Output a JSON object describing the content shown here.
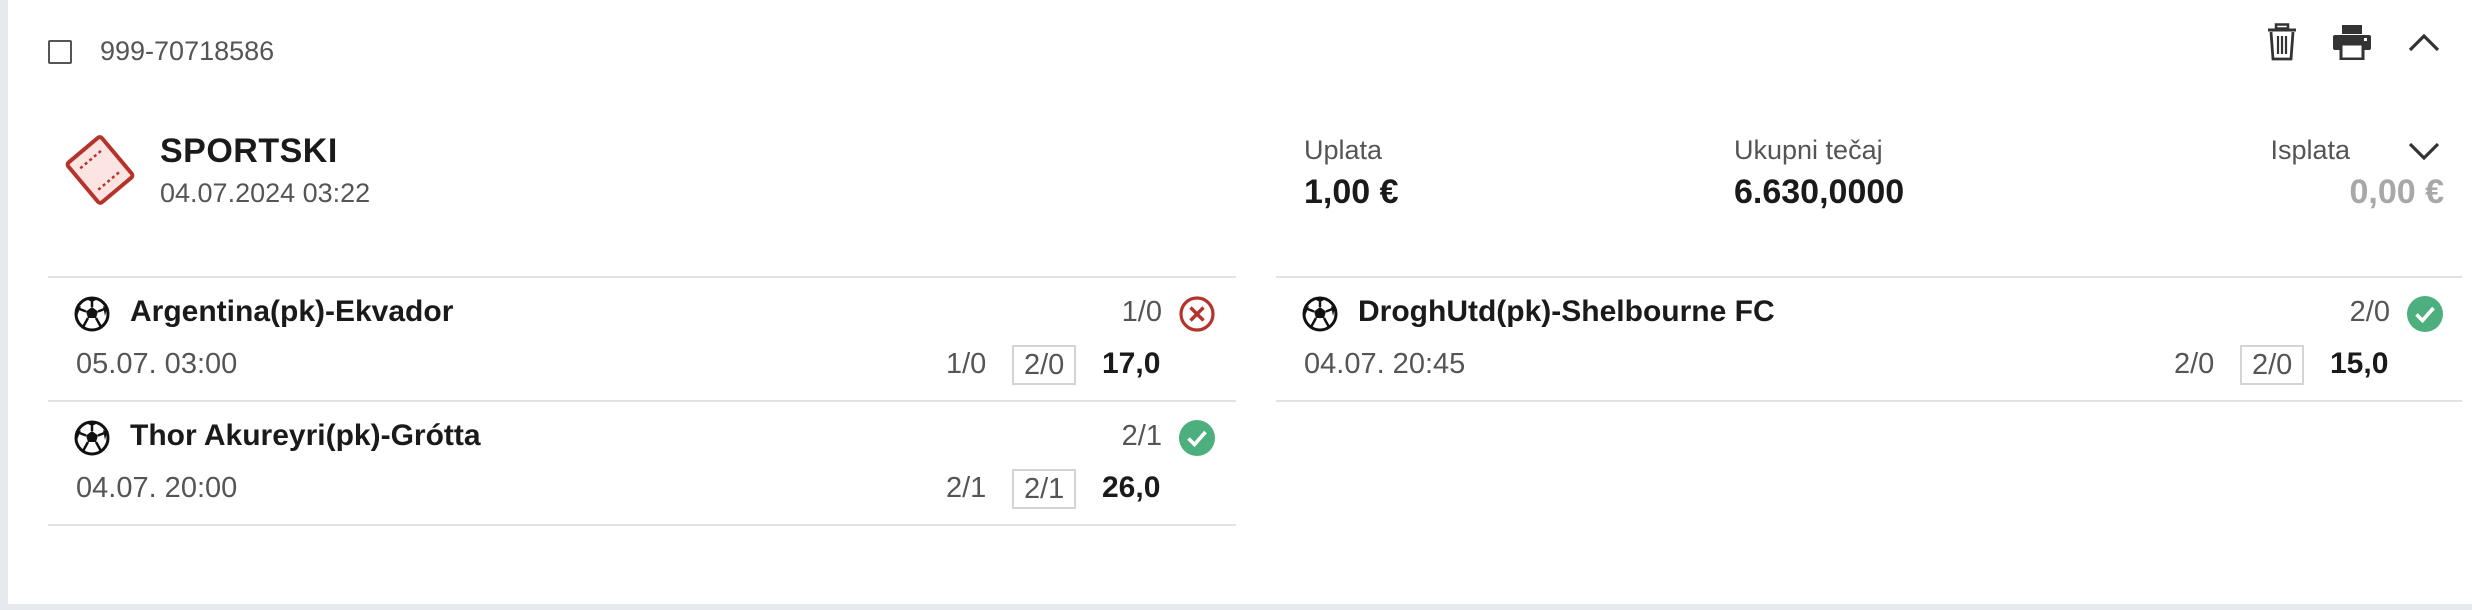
{
  "ticket": {
    "id": "999-70718586"
  },
  "summary": {
    "title": "SPORTSKI",
    "datetime": "04.07.2024 03:22",
    "stake_label": "Uplata",
    "stake_value": "1,00 €",
    "total_odds_label": "Ukupni tečaj",
    "total_odds_value": "6.630,0000",
    "payout_label": "Isplata",
    "payout_value": "0,00 €"
  },
  "icons": {
    "delete": "trash-icon",
    "print": "printer-icon",
    "collapse": "chevron-up-icon",
    "payout_toggle": "chevron-down-icon",
    "ticket": "ticket-icon",
    "sport": "soccer-ball-icon",
    "lost": "x-circle-icon",
    "won": "check-circle-icon"
  },
  "colors": {
    "accent_red": "#b5332a",
    "won_green": "#4caf7d",
    "muted_gray": "#a8a8a8"
  },
  "matches": [
    {
      "name": "Argentina(pk)-Ekvador",
      "result": "1/0",
      "status": "lost",
      "time": "05.07. 03:00",
      "tip": "1/0",
      "tip_boxed": "2/0",
      "odds": "17,0"
    },
    {
      "name": "Thor Akureyri(pk)-Grótta",
      "result": "2/1",
      "status": "won",
      "time": "04.07. 20:00",
      "tip": "2/1",
      "tip_boxed": "2/1",
      "odds": "26,0"
    },
    {
      "name": "DroghUtd(pk)-Shelbourne FC",
      "result": "2/0",
      "status": "won",
      "time": "04.07. 20:45",
      "tip": "2/0",
      "tip_boxed": "2/0",
      "odds": "15,0"
    }
  ]
}
